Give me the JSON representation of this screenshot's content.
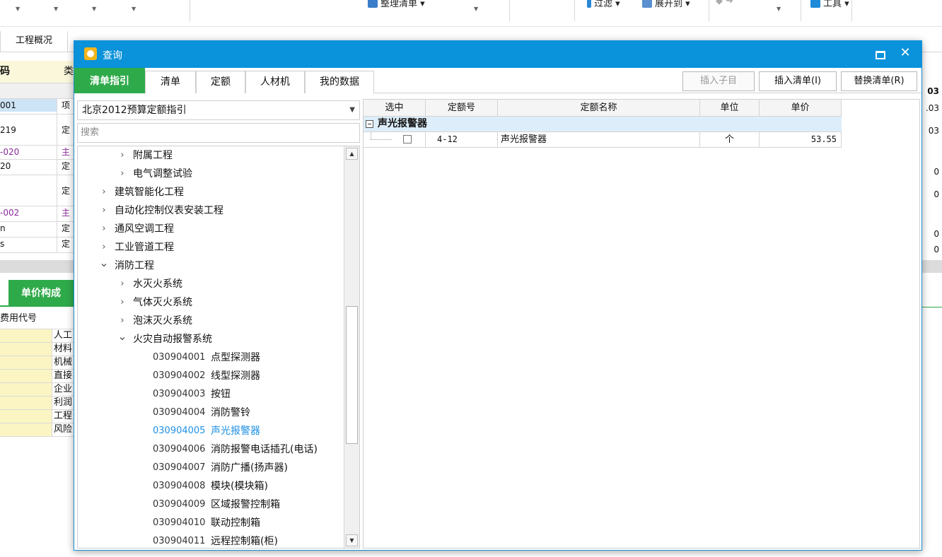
{
  "ribbon": {
    "partial_items": [
      "整理清单",
      "过滤",
      "展开到",
      "工具"
    ]
  },
  "background": {
    "tab_overview": "工程概况",
    "grid_header": "码",
    "grid_header2": "类",
    "rows": [
      {
        "c1": "001",
        "c2": "项",
        "purple": false
      },
      {
        "c1": "219",
        "c2": "定",
        "purple": false
      },
      {
        "c1": "-020",
        "c2": "主",
        "purple": true
      },
      {
        "c1": "20",
        "c2": "定",
        "purple": false
      },
      {
        "c1": "",
        "c2": "定",
        "purple": false
      },
      {
        "c1": "-002",
        "c2": "主",
        "purple": true
      },
      {
        "c1": "n",
        "c2": "定",
        "purple": false
      },
      {
        "c1": "s",
        "c2": "定",
        "purple": false
      }
    ],
    "right_values": [
      "03",
      ".03",
      "03",
      "0",
      "0",
      "0",
      "0"
    ],
    "lower_tab": "单价构成",
    "lower_header": "费用代号",
    "lower_rows": [
      "人工",
      "材料",
      "机械",
      "直接",
      "企业",
      "利润",
      "工程",
      "风险"
    ]
  },
  "dialog": {
    "title": "查询",
    "tabs": [
      "清单指引",
      "清单",
      "定额",
      "人材机",
      "我的数据"
    ],
    "active_tab": "清单指引",
    "buttons": {
      "insert_child": "插入子目",
      "insert_list": "插入清单(I)",
      "replace_list": "替换清单(R)"
    },
    "select_value": "北京2012预算定额指引",
    "search_placeholder": "搜索",
    "tree": [
      {
        "level": 2,
        "chev": "right",
        "text": "附属工程"
      },
      {
        "level": 2,
        "chev": "right",
        "text": "电气调整试验"
      },
      {
        "level": 1,
        "chev": "right",
        "text": "建筑智能化工程"
      },
      {
        "level": 1,
        "chev": "right",
        "text": "自动化控制仪表安装工程"
      },
      {
        "level": 1,
        "chev": "right",
        "text": "通风空调工程"
      },
      {
        "level": 1,
        "chev": "right",
        "text": "工业管道工程"
      },
      {
        "level": 1,
        "chev": "down",
        "text": "消防工程"
      },
      {
        "level": 2,
        "chev": "right",
        "text": "水灭火系统"
      },
      {
        "level": 2,
        "chev": "right",
        "text": "气体灭火系统"
      },
      {
        "level": 2,
        "chev": "right",
        "text": "泡沫灭火系统"
      },
      {
        "level": 2,
        "chev": "down",
        "text": "火灾自动报警系统"
      },
      {
        "level": 3,
        "code": "030904001",
        "text": "点型探测器"
      },
      {
        "level": 3,
        "code": "030904002",
        "text": "线型探测器"
      },
      {
        "level": 3,
        "code": "030904003",
        "text": "按钮"
      },
      {
        "level": 3,
        "code": "030904004",
        "text": "消防警铃"
      },
      {
        "level": 3,
        "code": "030904005",
        "text": "声光报警器",
        "selected": true
      },
      {
        "level": 3,
        "code": "030904006",
        "text": "消防报警电话插孔(电话)"
      },
      {
        "level": 3,
        "code": "030904007",
        "text": "消防广播(扬声器)"
      },
      {
        "level": 3,
        "code": "030904008",
        "text": "模块(模块箱)"
      },
      {
        "level": 3,
        "code": "030904009",
        "text": "区域报警控制箱"
      },
      {
        "level": 3,
        "code": "030904010",
        "text": "联动控制箱"
      },
      {
        "level": 3,
        "code": "030904011",
        "text": "远程控制箱(柜)"
      }
    ],
    "table": {
      "headers": [
        "选中",
        "定额号",
        "定额名称",
        "单位",
        "单价"
      ],
      "group": "声光报警器",
      "rows": [
        {
          "checked": false,
          "code": "4-12",
          "name": "声光报警器",
          "unit": "个",
          "price": "53.55"
        }
      ]
    },
    "colors": {
      "titlebar": "#0a92da",
      "active_tab": "#2faa4a",
      "selected_tree_text": "#1e90e6",
      "group_row": "#ddeefa"
    }
  }
}
